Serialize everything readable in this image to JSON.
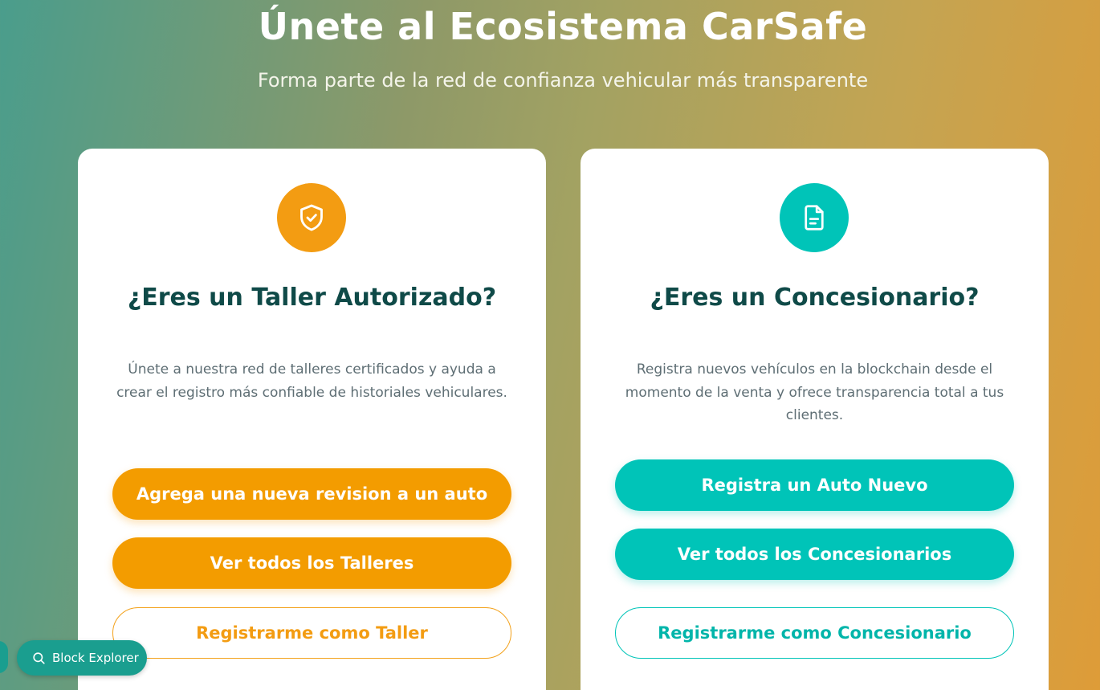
{
  "hero": {
    "title": "Únete al Ecosistema CarSafe",
    "subtitle": "Forma parte de la red de confianza vehicular más transparente"
  },
  "workshop_card": {
    "icon": "shield-check-icon",
    "title": "¿Eres un Taller Autorizado?",
    "description": "Únete a nuestra red de talleres certificados y ayuda a crear el registro más confiable de historiales vehiculares.",
    "buttons": {
      "add_revision": "Agrega una nueva revision a un auto",
      "view_all": "Ver todos los Talleres",
      "register": "Registrarme como Taller"
    }
  },
  "dealer_card": {
    "icon": "document-icon",
    "title": "¿Eres un Concesionario?",
    "description": "Registra nuevos vehículos en la blockchain desde el momento de la venta y ofrece transparencia total a tus clientes.",
    "buttons": {
      "register_car": "Registra un Auto Nuevo",
      "view_all": "Ver todos los Concesionarios",
      "register": "Registrarme como Concesionario"
    }
  },
  "block_explorer": {
    "label": "Block Explorer",
    "icon": "search-icon"
  },
  "colors": {
    "orange": "#f39c00",
    "teal": "#00c4b8",
    "title_dark": "#0f4a48"
  }
}
